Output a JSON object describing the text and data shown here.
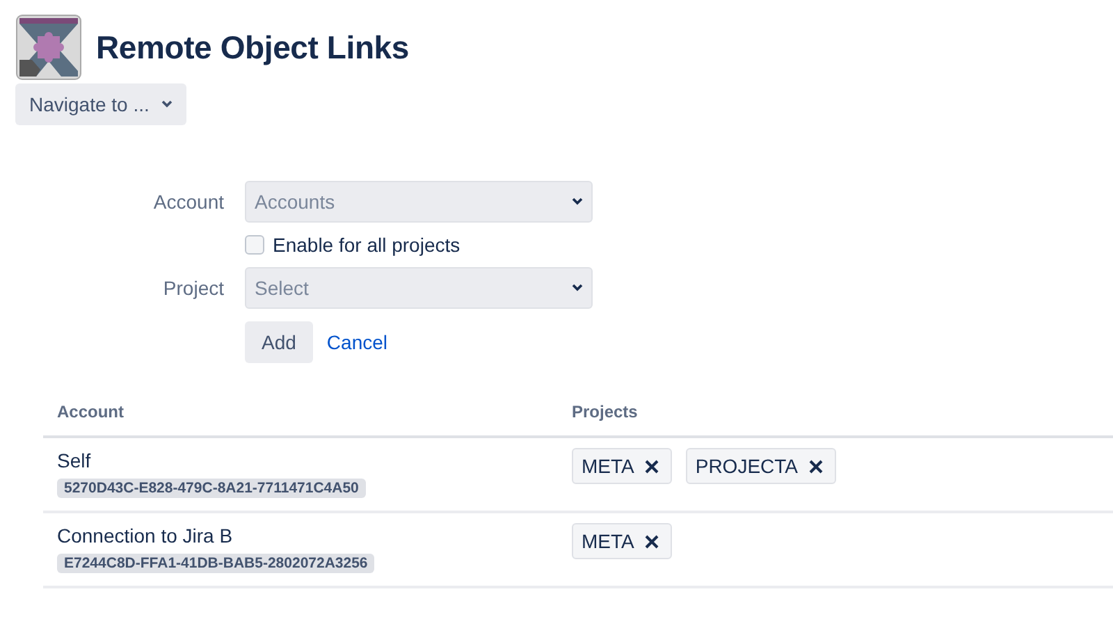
{
  "header": {
    "title": "Remote Object Links",
    "navigate": "Navigate to ..."
  },
  "form": {
    "account": {
      "label": "Account",
      "placeholder": "Accounts"
    },
    "enable_all": {
      "label": "Enable for all projects",
      "checked": false
    },
    "project": {
      "label": "Project",
      "placeholder": "Select"
    },
    "buttons": {
      "add": "Add",
      "cancel": "Cancel"
    }
  },
  "table": {
    "columns": [
      "Account",
      "Projects"
    ],
    "rows": [
      {
        "account": "Self",
        "id": "5270D43C-E828-479C-8A21-7711471C4A50",
        "projects": [
          "META",
          "PROJECTA"
        ]
      },
      {
        "account": "Connection to Jira B",
        "id": "E7244C8D-FFA1-41DB-BAB5-2802072A3256",
        "projects": [
          "META"
        ]
      }
    ]
  }
}
